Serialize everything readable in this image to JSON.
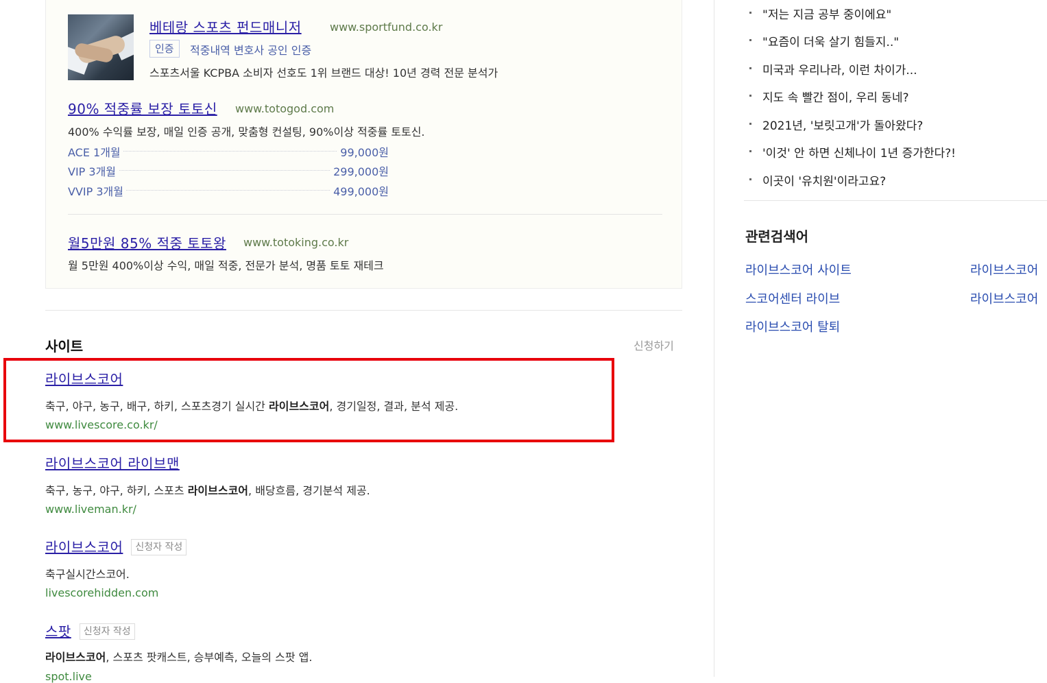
{
  "ads": {
    "ad1": {
      "title": "베테랑 스포츠 펀드매니저",
      "url": "www.sportfund.co.kr",
      "badge": "인증",
      "cert": "적중내역 변호사 공인 인증",
      "desc": "스포츠서울 KCPBA 소비자 선호도 1위 브랜드 대상! 10년 경력 전문 분석가"
    },
    "ad2": {
      "title": "90% 적중률 보장 토토신",
      "url": "www.totogod.com",
      "desc": "400% 수익률 보장, 매일 인증 공개, 맞춤형 컨설팅, 90%이상 적중률 토토신.",
      "prices": [
        {
          "label": "ACE 1개월",
          "value": "99,000원"
        },
        {
          "label": "VIP 3개월",
          "value": "299,000원"
        },
        {
          "label": "VVIP 3개월",
          "value": "499,000원"
        }
      ]
    },
    "ad3": {
      "title": "월5만원 85% 적중 토토왕",
      "url": "www.totoking.co.kr",
      "desc": "월 5만원 400%이상 수익, 매일 적중, 전문가 분석, 명품 토토 재테크"
    }
  },
  "site_section": {
    "title": "사이트",
    "apply": "신청하기",
    "results": [
      {
        "title": "라이브스코어",
        "desc_pre": "축구, 야구, 농구, 배구, 하키, 스포츠경기 실시간 ",
        "desc_bold": "라이브스코어",
        "desc_post": ", 경기일정, 결과, 분석 제공.",
        "url": "www.livescore.co.kr/"
      },
      {
        "title": "라이브스코어 라이브맨",
        "desc_pre": "축구, 농구, 야구, 하키, 스포츠 ",
        "desc_bold": "라이브스코어",
        "desc_post": ", 배당흐름, 경기분석 제공.",
        "url": "www.liveman.kr/"
      },
      {
        "title": "라이브스코어",
        "tag": "신청자 작성",
        "desc_pre": "축구실시간스코어.",
        "url": "livescorehidden.com"
      },
      {
        "title": "스팟",
        "tag": "신청자 작성",
        "desc_bold": "라이브스코어",
        "desc_post": ", 스포츠 팟캐스트, 승부예측, 오늘의 스팟 앱.",
        "url": "spot.live"
      }
    ]
  },
  "news": [
    "\"저는 지금 공부 중이에요\"",
    "\"요즘이 더욱 살기 힘들지..\"",
    "미국과 우리나라, 이런 차이가...",
    "지도 속 빨간 점이, 우리 동네?",
    "2021년, '보릿고개'가 돌아왔다?",
    "'이것' 안 하면 신체나이 1년 증가한다?!",
    "이곳이 '유치원'이라고요?"
  ],
  "related": {
    "title": "관련검색어",
    "items": [
      "라이브스코어 사이트",
      "라이브스코어",
      "스코어센터 라이브",
      "라이브스코어",
      "라이브스코어 탈퇴"
    ]
  },
  "colors": {
    "link": "#2a1fa6",
    "url_green": "#3f8a3f",
    "highlight": "#e8000b"
  }
}
